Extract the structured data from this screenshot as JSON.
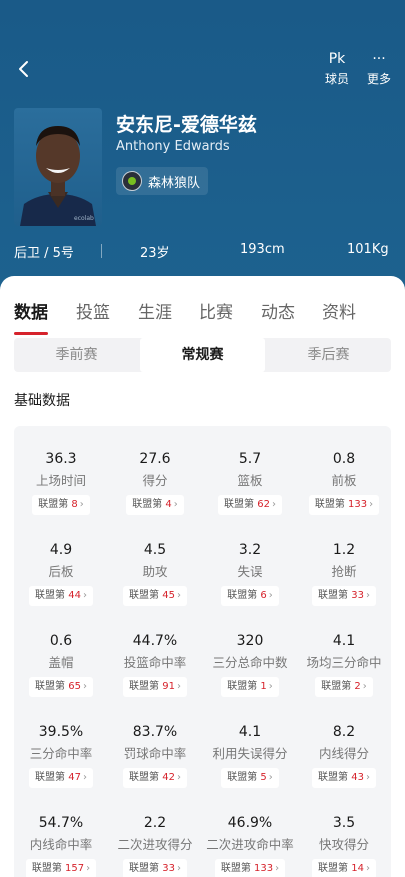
{
  "header": {
    "player_btn": {
      "glyph": "Pk",
      "label": "球员"
    },
    "more_btn": {
      "glyph": "···",
      "label": "更多"
    }
  },
  "player": {
    "name_cn": "安东尼-爱德华兹",
    "name_en": "Anthony Edwards",
    "team": "森林狼队",
    "position_number": "后卫 / 5号",
    "age": "23岁",
    "height": "193cm",
    "weight": "101Kg"
  },
  "tabs": [
    "数据",
    "投篮",
    "生涯",
    "比赛",
    "动态",
    "资料"
  ],
  "segments": [
    "季前赛",
    "常规赛",
    "季后赛"
  ],
  "section_title": "基础数据",
  "rank_prefix": "联盟第",
  "stats": [
    {
      "value": "36.3",
      "label": "上场时间",
      "rank": "8"
    },
    {
      "value": "27.6",
      "label": "得分",
      "rank": "4"
    },
    {
      "value": "5.7",
      "label": "篮板",
      "rank": "62"
    },
    {
      "value": "0.8",
      "label": "前板",
      "rank": "133"
    },
    {
      "value": "4.9",
      "label": "后板",
      "rank": "44"
    },
    {
      "value": "4.5",
      "label": "助攻",
      "rank": "45"
    },
    {
      "value": "3.2",
      "label": "失误",
      "rank": "6"
    },
    {
      "value": "1.2",
      "label": "抢断",
      "rank": "33"
    },
    {
      "value": "0.6",
      "label": "盖帽",
      "rank": "65"
    },
    {
      "value": "44.7%",
      "label": "投篮命中率",
      "rank": "91"
    },
    {
      "value": "320",
      "label": "三分总命中数",
      "rank": "1"
    },
    {
      "value": "4.1",
      "label": "场均三分命中",
      "rank": "2"
    },
    {
      "value": "39.5%",
      "label": "三分命中率",
      "rank": "47"
    },
    {
      "value": "83.7%",
      "label": "罚球命中率",
      "rank": "42"
    },
    {
      "value": "4.1",
      "label": "利用失误得分",
      "rank": "5"
    },
    {
      "value": "8.2",
      "label": "内线得分",
      "rank": "43"
    },
    {
      "value": "54.7%",
      "label": "内线命中率",
      "rank": "157"
    },
    {
      "value": "2.2",
      "label": "二次进攻得分",
      "rank": "33"
    },
    {
      "value": "46.9%",
      "label": "二次进攻命中率",
      "rank": "133"
    },
    {
      "value": "3.5",
      "label": "快攻得分",
      "rank": "14"
    }
  ]
}
